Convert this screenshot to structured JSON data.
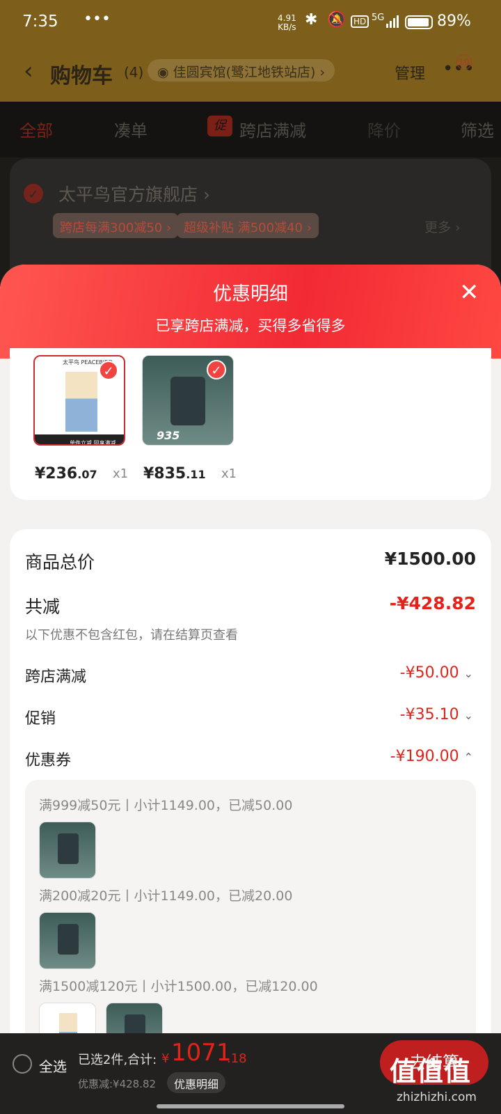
{
  "status": {
    "time": "7:35",
    "dots": "•••",
    "net_speed": "4.91",
    "net_unit": "KB/s",
    "signal": "5G",
    "battery": "89%"
  },
  "header": {
    "title": "购物车",
    "count": "(4)",
    "location": "佳圆宾馆(鹭江地铁站店)",
    "manage": "管理",
    "badge": "10"
  },
  "tabs": [
    {
      "label": "全部"
    },
    {
      "label": "凑单"
    },
    {
      "label": "跨店满减",
      "badge": "促"
    },
    {
      "label": "降价"
    },
    {
      "label": "筛选"
    }
  ],
  "store": {
    "name": "太平鸟官方旗舰店",
    "tags": [
      "跨店每满300减50",
      "超级补贴 满500减40"
    ],
    "more": "更多"
  },
  "sheet": {
    "title": "优惠明细",
    "subtitle": "已享跨店满减，买得多省得多",
    "products": [
      {
        "brand": "太平鸟 PEACEBIRD",
        "price_int": "¥236",
        "price_dec": ".07",
        "qty": "x1",
        "label": "单件立减 同享满减"
      },
      {
        "price_int": "¥835",
        "price_dec": ".11",
        "qty": "x1",
        "label": "935"
      }
    ],
    "total_label": "商品总价",
    "total": "¥1500.00",
    "reduce_label": "共减",
    "reduce": "-¥428.82",
    "note": "以下优惠不包含红包，请在结算页查看",
    "rows": [
      {
        "label": "跨店满减",
        "value": "-¥50.00",
        "caret": "⌄"
      },
      {
        "label": "促销",
        "value": "-¥35.10",
        "caret": "⌄"
      },
      {
        "label": "优惠券",
        "value": "-¥190.00",
        "caret": "⌃"
      }
    ],
    "coupons": [
      {
        "text": "满999减50元丨小计1149.00，已减50.00"
      },
      {
        "text": "满200减20元丨小计1149.00，已减20.00"
      },
      {
        "text": "满1500减120元丨小计1500.00，已减120.00"
      }
    ]
  },
  "bottom": {
    "select_all": "全选",
    "selected": "已选2件,合计:",
    "sym": "¥",
    "total_int": "1071",
    "total_dec": ".18",
    "discount": "优惠减:¥428.82",
    "detail": "优惠明细",
    "checkout": "去结算"
  },
  "watermark": {
    "logo": "值值值",
    "url": "zhizhizhi.com"
  }
}
